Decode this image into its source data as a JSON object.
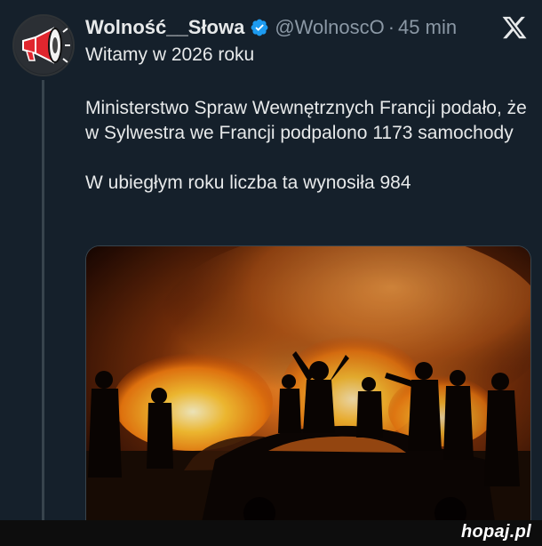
{
  "tweet": {
    "display_name": "Wolność__Słowa",
    "handle": "@WolnoscO",
    "separator": "·",
    "time": "45 min",
    "lines": [
      "Witamy w 2026 roku",
      "Ministerstwo Spraw Wewnętrznych Francji podało, że w Sylwestra we Francji podpalono 1173 samochody",
      "W ubiegłym roku liczba ta wynosiła 984"
    ]
  },
  "colors": {
    "background": "#15202b",
    "verified": "#1d9bf0",
    "fire": "#ff9a1f",
    "avatar_accent": "#e0262e"
  },
  "icons": {
    "verified": "verified-badge-icon",
    "x_logo": "x-logo-icon",
    "avatar": "megaphone-icon"
  },
  "watermark": "hopaj.pl"
}
